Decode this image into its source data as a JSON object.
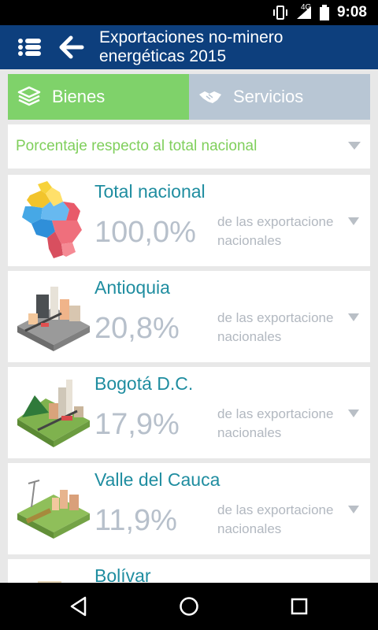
{
  "status_bar": {
    "time": "9:08",
    "network": "4G"
  },
  "app_bar": {
    "title": "Exportaciones no-minero\nenergéticas 2015"
  },
  "tabs": [
    {
      "label": "Bienes"
    },
    {
      "label": "Servicios"
    }
  ],
  "filter": {
    "label": "Porcentaje respecto al total nacional"
  },
  "cards": [
    {
      "name": "Total nacional",
      "percent": "100,0%",
      "desc_line1": "de las exportacione",
      "desc_line2": "nacionales"
    },
    {
      "name": "Antioquia",
      "percent": "20,8%",
      "desc_line1": "de las exportacione",
      "desc_line2": "nacionales"
    },
    {
      "name": "Bogotá D.C.",
      "percent": "17,9%",
      "desc_line1": "de las exportacione",
      "desc_line2": "nacionales"
    },
    {
      "name": "Valle del Cauca",
      "percent": "11,9%",
      "desc_line1": "de las exportacione",
      "desc_line2": "nacionales"
    },
    {
      "name": "Bolívar"
    }
  ],
  "colors": {
    "app_bar": "#0d3f7d",
    "active_tab": "#7fd26a",
    "inactive_tab": "#b8c6d4",
    "card_title": "#1f8da0",
    "percent": "#b7c0cb",
    "filter_text": "#7fcf5b"
  }
}
